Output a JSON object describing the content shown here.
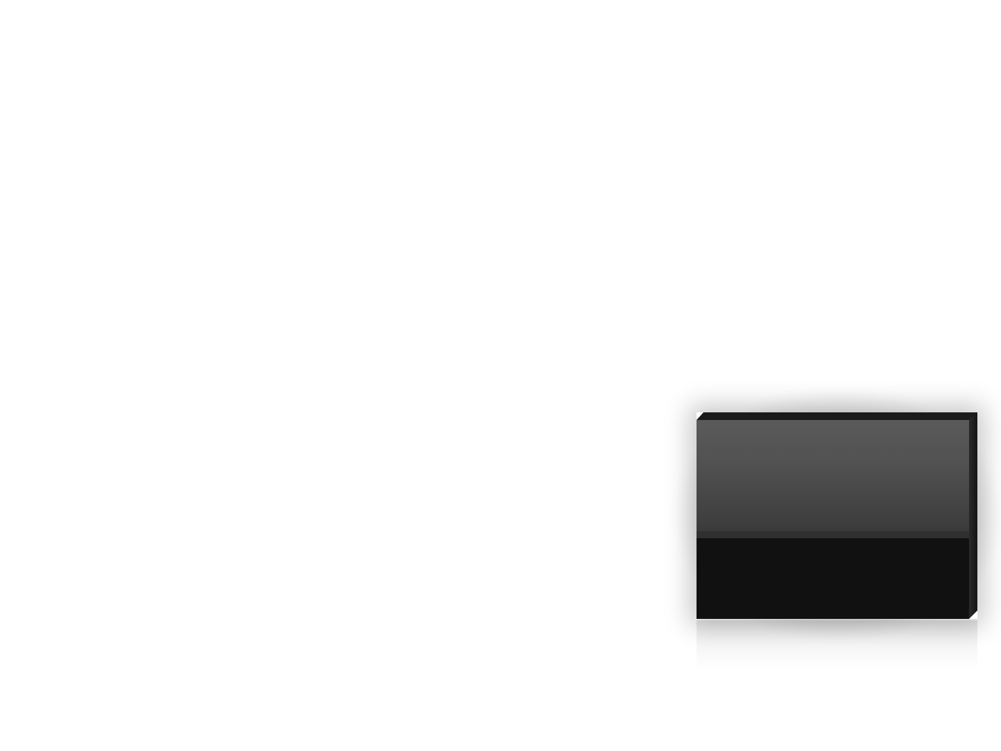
{
  "slide": {
    "background_color": "#ffffff"
  },
  "slab": {
    "gloss_color": "#555555",
    "body_color": "#111111",
    "edge_color": "#1b1b1b"
  }
}
